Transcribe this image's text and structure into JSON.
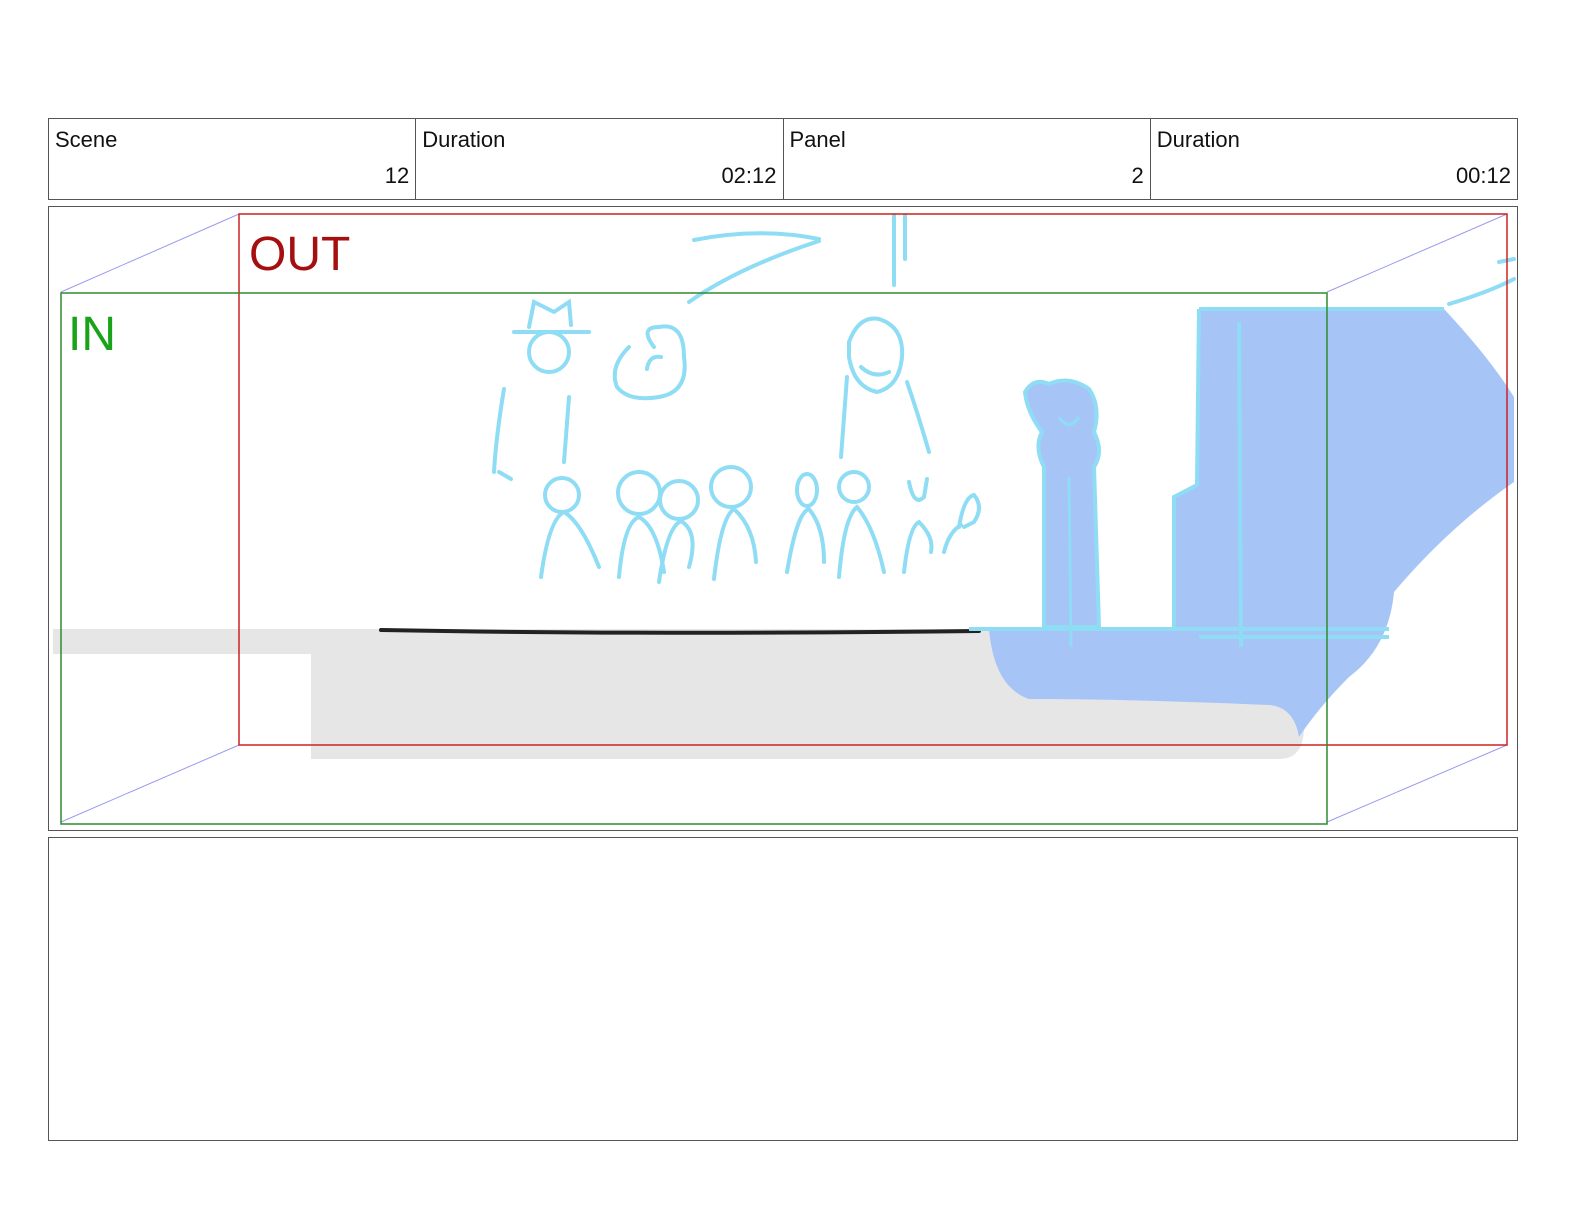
{
  "info": {
    "scene_label": "Scene",
    "scene_value": "12",
    "scene_duration_label": "Duration",
    "scene_duration_value": "02:12",
    "panel_label": "Panel",
    "panel_value": "2",
    "panel_duration_label": "Duration",
    "panel_duration_value": "00:12"
  },
  "frame": {
    "out_label": "OUT",
    "in_label": "IN"
  },
  "colors": {
    "out_frame": "#cc2222",
    "in_frame": "#2e8b2e",
    "sketch": "#8fdcf5",
    "fill_blue": "#a7c4f7",
    "ground_gray": "#e6e6e6"
  }
}
